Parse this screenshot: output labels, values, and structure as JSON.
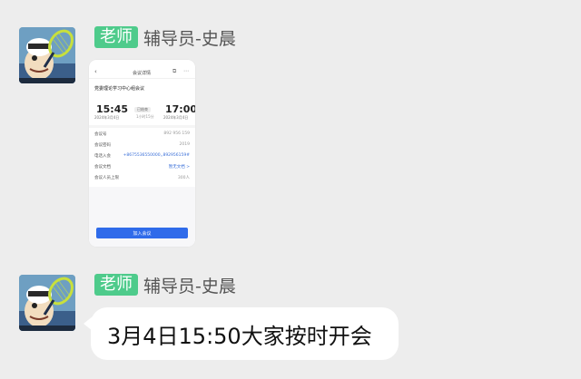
{
  "messages": [
    {
      "role_badge": "老师",
      "sender": "辅导员-史晨",
      "type": "image",
      "screenshot": {
        "header_title": "会议详情",
        "meeting_title": "党委理论学习中心组会议",
        "start_time": "15:45",
        "start_date": "2024年3月4日",
        "duration": "1小时15分",
        "duration_badge": "已结束",
        "end_time": "17:00",
        "end_date": "2024年3月4日",
        "rows": [
          {
            "label": "会议号",
            "value": "892 956 159"
          },
          {
            "label": "会议密码",
            "value": "2019"
          },
          {
            "label": "电话入会",
            "value": "+8675536550000,,892956159#"
          },
          {
            "label": "会议文档",
            "value": "暂无文档 >"
          },
          {
            "label": "会议人员上限",
            "value": "300人"
          }
        ],
        "join_label": "加入会议"
      }
    },
    {
      "role_badge": "老师",
      "sender": "辅导员-史晨",
      "type": "text",
      "text": "3月4日15:50大家按时开会"
    }
  ],
  "colors": {
    "background": "#ededed",
    "badge": "#4ecb8b",
    "bubble": "#ffffff",
    "join_button": "#2f6bea"
  },
  "icons": [
    "avatar-popeye",
    "back-arrow-icon",
    "share-icon",
    "more-icon"
  ]
}
